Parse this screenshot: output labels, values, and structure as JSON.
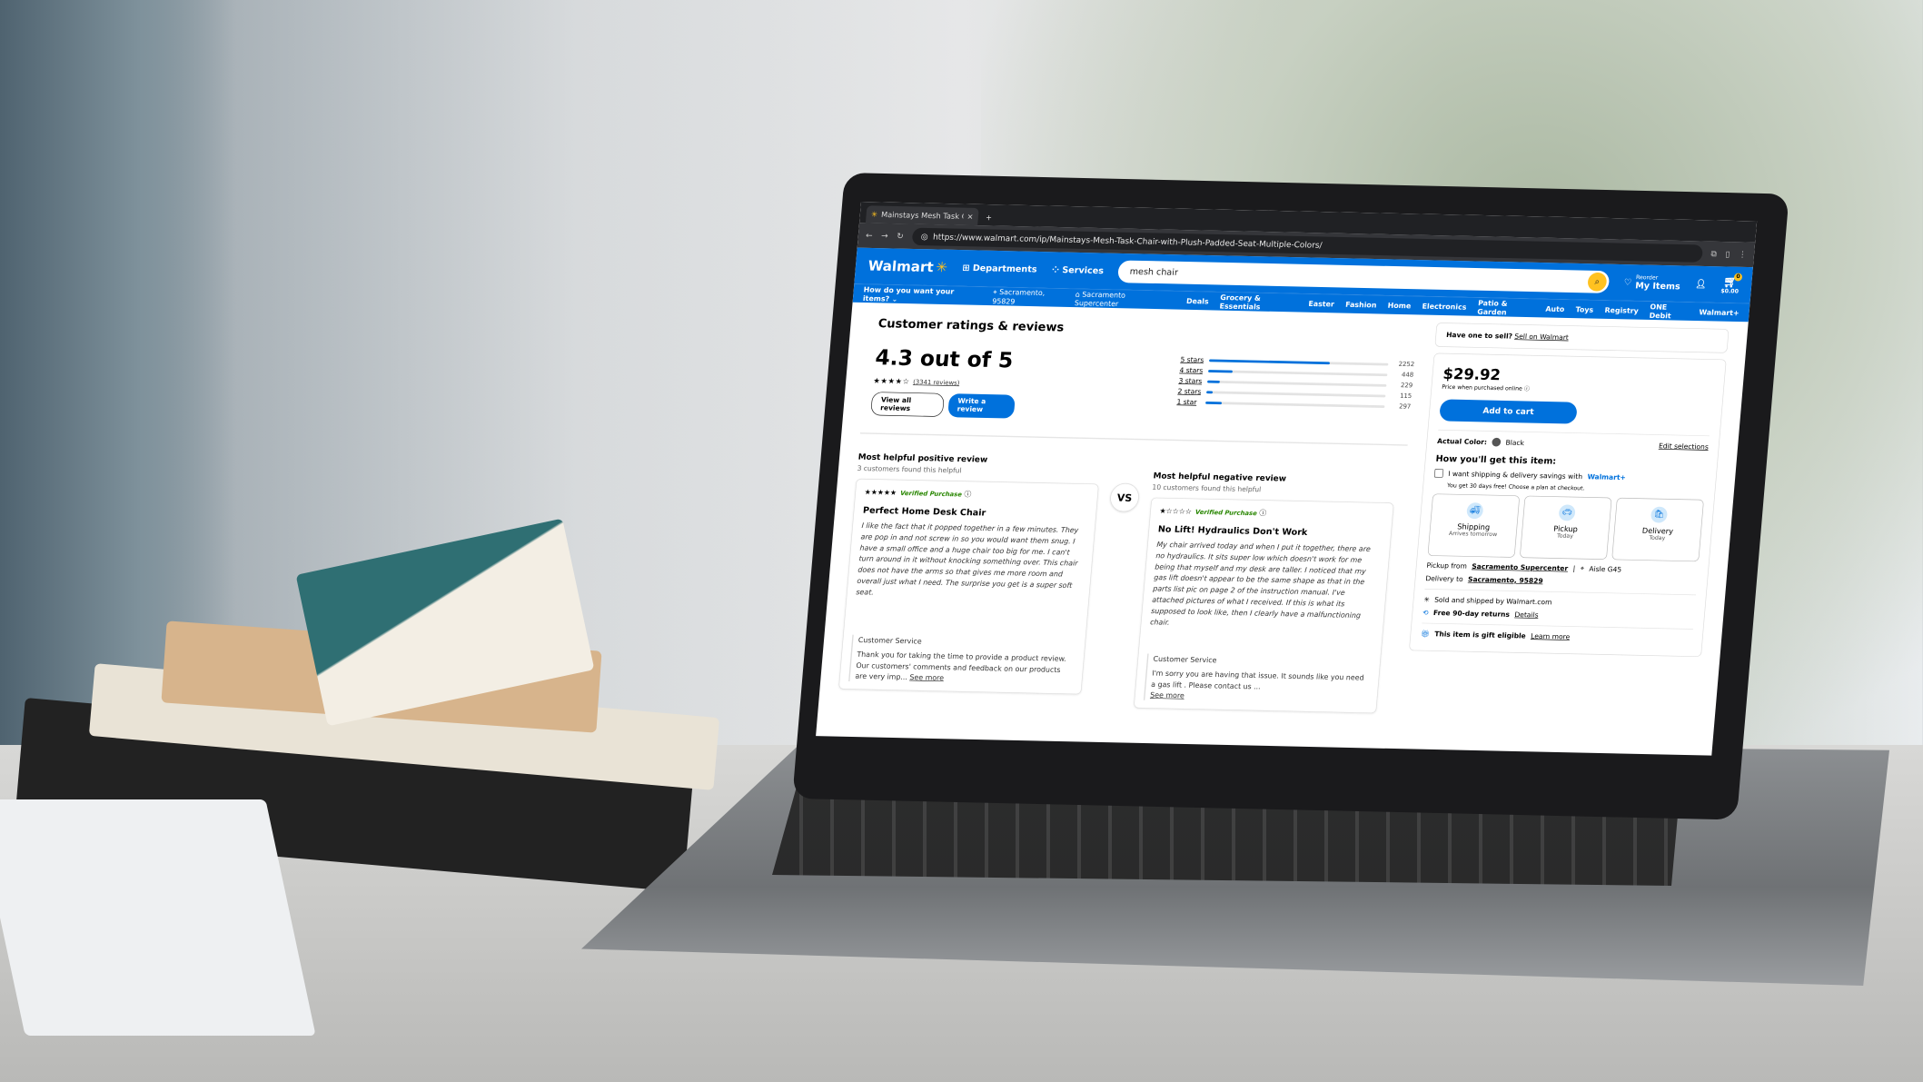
{
  "browser": {
    "tab_title": "Mainstays Mesh Task Chair w",
    "new_tab": "+",
    "url": "https://www.walmart.com/ip/Mainstays-Mesh-Task-Chair-with-Plush-Padded-Seat-Multiple-Colors/"
  },
  "header": {
    "logo": "Walmart",
    "departments": "Departments",
    "services": "Services",
    "search_value": "mesh chair",
    "reorder": "Reorder",
    "my_items": "My Items",
    "cart_total": "$0.00",
    "cart_count": "0"
  },
  "subnav": {
    "how": "How do you want your items?",
    "location": "Sacramento, 95829",
    "store": "Sacramento Supercenter",
    "links": [
      "Deals",
      "Grocery & Essentials",
      "Easter",
      "Fashion",
      "Home",
      "Electronics",
      "Patio & Garden",
      "Auto",
      "Toys",
      "Registry",
      "ONE Debit",
      "Walmart+"
    ]
  },
  "ratings": {
    "title": "Customer ratings & reviews",
    "score": "4.3 out of 5",
    "stars": "★★★★☆",
    "review_count": "(3341 reviews)",
    "view_all": "View all reviews",
    "write": "Write a review",
    "distribution": [
      {
        "label": "5 stars",
        "count": "2252",
        "value": 2252
      },
      {
        "label": "4 stars",
        "count": "448",
        "value": 448
      },
      {
        "label": "3 stars",
        "count": "229",
        "value": 229
      },
      {
        "label": "2 stars",
        "count": "115",
        "value": 115
      },
      {
        "label": "1 star",
        "count": "297",
        "value": 297
      }
    ]
  },
  "positive": {
    "heading": "Most helpful positive review",
    "helpful": "3 customers found this helpful",
    "stars": "★★★★★",
    "verified": "Verified Purchase",
    "title": "Perfect Home Desk Chair",
    "body": "I like the fact that it popped together in a few minutes. They are pop in and not screw in so you would want them snug. I have a small office and a huge chair too big for me. I can't turn around in it without knocking something over. This chair does not have the arms so that gives me more room and overall just what I need. The surprise you get is a super soft seat.",
    "cs_label": "Customer Service",
    "cs_text": "Thank you for taking the time to provide a product review. Our customers' comments and feedback on our products are very imp...",
    "see_more": "See more"
  },
  "vs": "VS",
  "negative": {
    "heading": "Most helpful negative review",
    "helpful": "10 customers found this helpful",
    "stars": "★☆☆☆☆",
    "verified": "Verified Purchase",
    "title": "No Lift! Hydraulics Don't Work",
    "body": "My chair arrived today and when I put it together, there are no hydraulics. It sits super low which doesn't work for me being that myself and my desk are taller. I noticed that my gas lift doesn't appear to be the same shape as that in the parts list pic on page 2 of the instruction manual. I've attached pictures of what I received. If this is what its supposed to look like, then I clearly have a malfunctioning chair.",
    "cs_label": "Customer Service",
    "cs_text": "I'm sorry you are having that issue. It sounds like you need a gas lift . Please contact us ...",
    "see_more": "See more"
  },
  "buybox": {
    "sell_q": "Have one to sell?",
    "sell_link": "Sell on Walmart",
    "price": "$29.92",
    "price_note": "Price when purchased online",
    "add_to_cart": "Add to cart",
    "color_label": "Actual Color:",
    "color_value": "Black",
    "edit": "Edit selections",
    "how_get": "How you'll get this item:",
    "walmart_plus_text": "I want shipping & delivery savings with",
    "walmart_plus": "Walmart+",
    "trial": "You get 30 days free! Choose a plan at checkout.",
    "options": [
      {
        "name": "Shipping",
        "sub": "Arrives tomorrow",
        "icon": "truck-icon"
      },
      {
        "name": "Pickup",
        "sub": "Today",
        "icon": "car-icon"
      },
      {
        "name": "Delivery",
        "sub": "Today",
        "icon": "bag-icon"
      }
    ],
    "pickup_label": "Pickup from",
    "pickup_store": "Sacramento Supercenter",
    "aisle": "Aisle G45",
    "delivery_label": "Delivery to",
    "delivery_loc": "Sacramento, 95829",
    "sold_by": "Sold and shipped by Walmart.com",
    "returns": "Free 90-day returns",
    "details": "Details",
    "gift": "This item is gift eligible",
    "learn_more": "Learn more"
  },
  "colors": {
    "walmart_blue": "#0071dc",
    "spark_yellow": "#ffc220",
    "verified_green": "#2a8703"
  }
}
